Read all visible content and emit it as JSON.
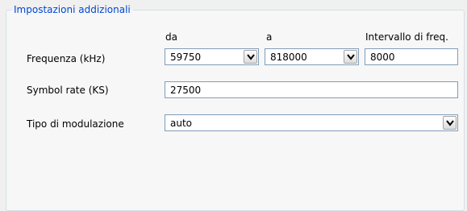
{
  "section_title": "Impostazioni addizionali",
  "column_headers": {
    "from": "da",
    "to": "a",
    "step": "Intervallo di freq."
  },
  "frequency": {
    "label": "Frequenza (kHz)",
    "from_value": "59750",
    "to_value": "818000",
    "step_value": "8000"
  },
  "symbol_rate": {
    "label": "Symbol rate (KS)",
    "value": "27500"
  },
  "modulation": {
    "label": "Tipo di modulazione",
    "value": "auto"
  },
  "icons": {
    "dropdown": "chevron-down-icon"
  }
}
